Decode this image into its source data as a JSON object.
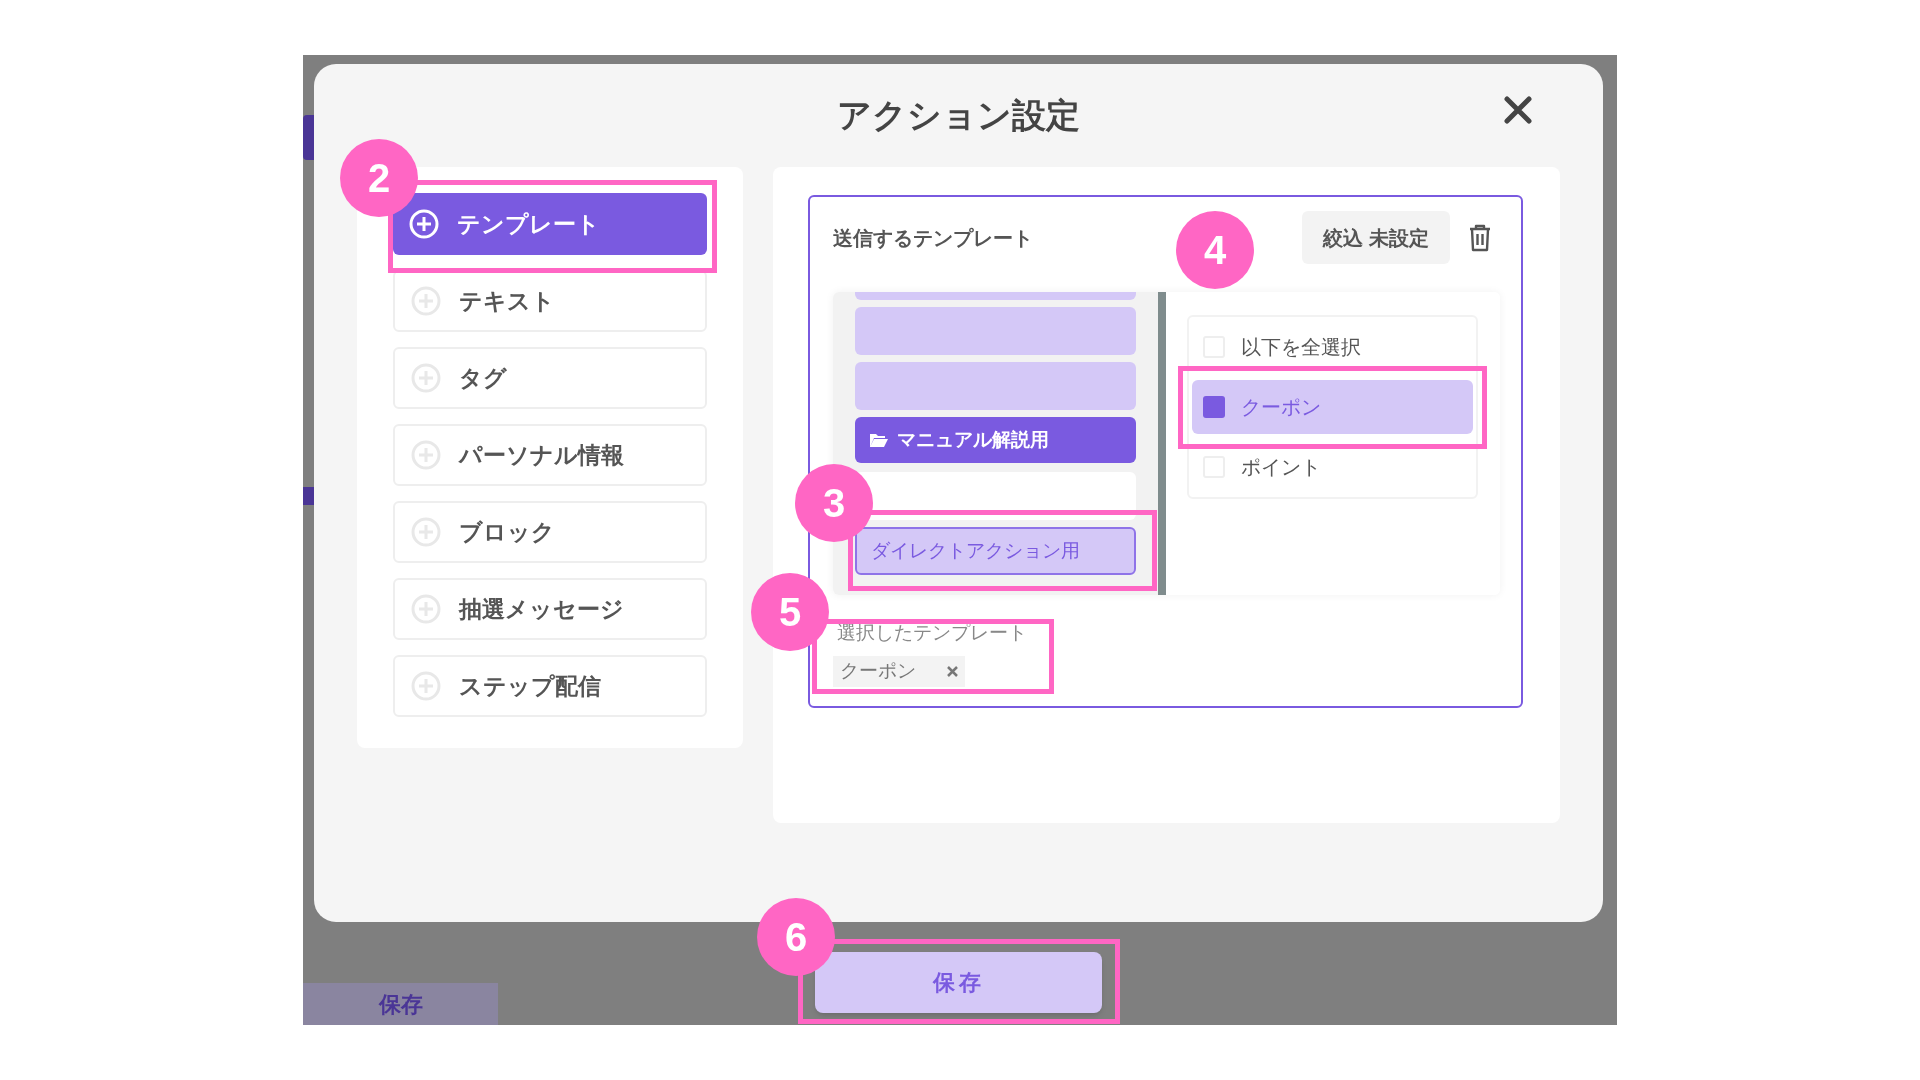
{
  "background": {
    "save_tab": "保存"
  },
  "modal": {
    "title": "アクション設定"
  },
  "action_types": [
    {
      "label": "テンプレート",
      "selected": true
    },
    {
      "label": "テキスト",
      "selected": false
    },
    {
      "label": "タグ",
      "selected": false
    },
    {
      "label": "パーソナル情報",
      "selected": false
    },
    {
      "label": "ブロック",
      "selected": false
    },
    {
      "label": "抽選メッセージ",
      "selected": false
    },
    {
      "label": "ステップ配信",
      "selected": false
    }
  ],
  "template_card": {
    "title": "送信するテンプレート",
    "filter_button": "絞込 未設定",
    "folders": [
      {
        "kind": "cut"
      },
      {
        "kind": "bar"
      },
      {
        "kind": "bar"
      },
      {
        "kind": "folder",
        "label": "マニュアル解説用"
      },
      {
        "kind": "empty"
      },
      {
        "kind": "outlined",
        "label": "ダイレクトアクション用"
      }
    ],
    "templates": [
      {
        "label": "以下を全選択",
        "checked": false
      },
      {
        "label": "クーポン",
        "checked": true
      },
      {
        "label": "ポイント",
        "checked": false
      }
    ],
    "selected_label": "選択したテンプレート",
    "selected_tags": [
      {
        "label": "クーポン"
      }
    ]
  },
  "save_button": "保存",
  "annotations": [
    {
      "number": "2"
    },
    {
      "number": "3"
    },
    {
      "number": "4"
    },
    {
      "number": "5"
    },
    {
      "number": "6"
    }
  ]
}
